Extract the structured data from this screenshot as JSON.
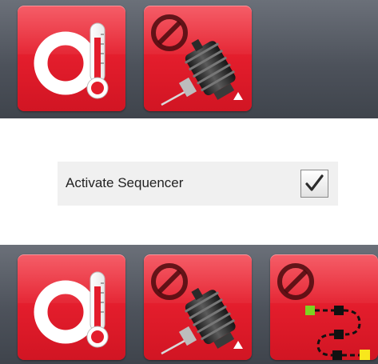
{
  "top_toolbar": {
    "tiles": [
      {
        "icon": "temperature-control-icon"
      },
      {
        "icon": "disabled-syringe-pump-icon"
      }
    ]
  },
  "sequencer": {
    "label": "Activate Sequencer",
    "checked": true,
    "icon": "checkmark-icon"
  },
  "bottom_toolbar": {
    "tiles": [
      {
        "icon": "temperature-control-icon"
      },
      {
        "icon": "disabled-syringe-pump-icon"
      },
      {
        "icon": "disabled-sequencer-icon"
      }
    ]
  },
  "colors": {
    "tile_red": "#e31d2c",
    "panel_gray": "#4d525b",
    "sequence_start": "#7ed321",
    "sequence_end": "#f8e71c"
  }
}
